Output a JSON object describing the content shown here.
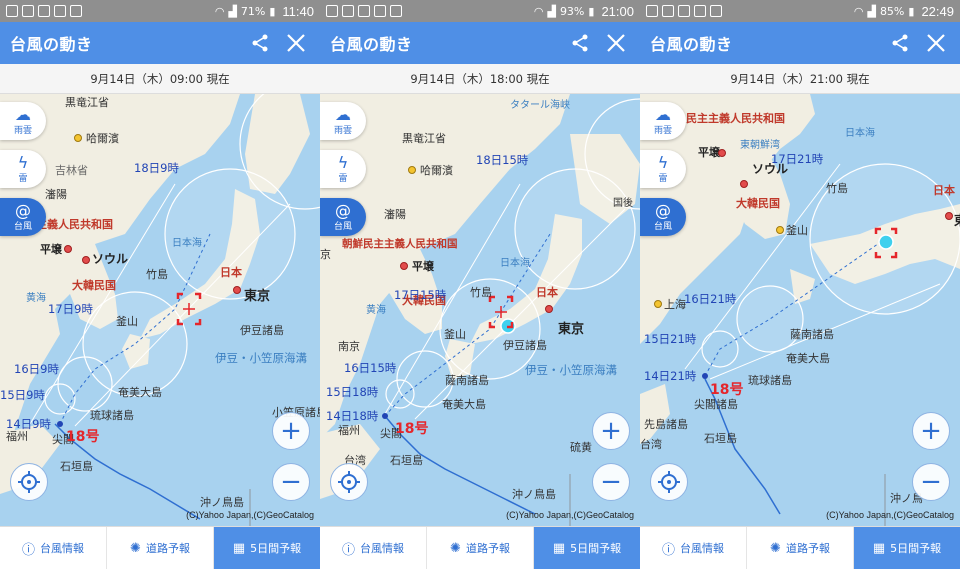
{
  "colors": {
    "appbar": "#4f8fe6",
    "sea": "#a8d2ef",
    "land": "#f1eee2",
    "track": "#2f6fd1",
    "typhoon_name": "#e5262b"
  },
  "common": {
    "app_title": "台風の動き",
    "side": {
      "rain": "雨雲",
      "thunder": "雷",
      "typhoon": "台風"
    },
    "tabs": [
      "台風情報",
      "道路予報",
      "5日間予報"
    ],
    "credit": "(C)Yahoo Japan,(C)GeoCatalog"
  },
  "screens": [
    {
      "status": {
        "battery": "71%",
        "time": "11:40"
      },
      "date": "9月14日（木）09:00 現在",
      "labels": {
        "heilongjiang": "黒竜江省",
        "harbin": "哈爾濱",
        "jilin": "吉林省",
        "shenyang": "瀋陽",
        "dprk": "主主義人民共和国",
        "pyongyang": "平壌",
        "seoul": "ソウル",
        "rok": "大韓民国",
        "yellow_sea": "黄海",
        "takeshima": "竹島",
        "japan_sea": "日本海",
        "japan": "日本",
        "tokyo": "東京",
        "busan": "釜山",
        "izu": "伊豆諸島",
        "trench": "伊豆・小笠原海溝",
        "amami": "奄美大島",
        "ryukyu": "琉球諸島",
        "fuzhou": "福州",
        "sen": "尖閣",
        "ishigaki": "石垣島",
        "ogasawara": "小笠原諸島",
        "okinotori": "沖ノ鳥島",
        "t18_9": "18日9時",
        "t17_9": "17日9時",
        "t16_9": "16日9時",
        "t15_9": "15日9時",
        "t14_9": "14日9時",
        "name": "18号"
      }
    },
    {
      "status": {
        "battery": "93%",
        "time": "21:00"
      },
      "date": "9月14日（木）18:00 現在",
      "labels": {
        "tatar": "タタール海峡",
        "heilongjiang": "黒竜江省",
        "harbin": "哈爾濱",
        "shenyang": "瀋陽",
        "dprk": "朝鮮民主主義人民共和国",
        "pyongyang": "平壌",
        "rok": "大韓民国",
        "yellow_sea": "黄海",
        "takeshima": "竹島",
        "japan_sea": "日本海",
        "japan": "日本",
        "tokyo": "東京",
        "busan": "釜山",
        "izu": "伊豆諸島",
        "trench": "伊豆・小笠原海溝",
        "satsunan": "薩南諸島",
        "amami": "奄美大島",
        "fuzhou": "福州",
        "sen": "尖閣",
        "ishigaki": "石垣島",
        "taiwan": "台湾",
        "iou": "硫黄",
        "okinotori": "沖ノ鳥島",
        "nanjing": "南京",
        "hokkaido": "国後",
        "pref": "京",
        "t18_15": "18日15時",
        "t17_15": "17日15時",
        "t16_15": "16日15時",
        "t15_18": "15日18時",
        "t14_18": "14日18時",
        "name": "18号"
      }
    },
    {
      "status": {
        "battery": "85%",
        "time": "22:49"
      },
      "date": "9月14日（木）21:00 現在",
      "labels": {
        "dprk": "民主主義人民共和国",
        "pyongyang": "平壌",
        "east_korea_bay": "東朝鮮湾",
        "seoul": "ソウル",
        "rok": "大韓民国",
        "busan": "釜山",
        "takeshima": "竹島",
        "japan_sea": "日本海",
        "japan": "日本",
        "tokyo": "東",
        "shanghai": "上海",
        "satsunan": "薩南諸島",
        "amami": "奄美大島",
        "ryukyu": "琉球諸島",
        "sen": "尖閣諸島",
        "sakishima": "先島諸島",
        "ishigaki": "石垣島",
        "taiwan": "台湾",
        "okinotori": "沖ノ鳥",
        "t17_21": "17日21時",
        "t16_21": "16日21時",
        "t15_21": "15日21時",
        "t14_21": "14日21時",
        "name": "18号"
      }
    }
  ]
}
